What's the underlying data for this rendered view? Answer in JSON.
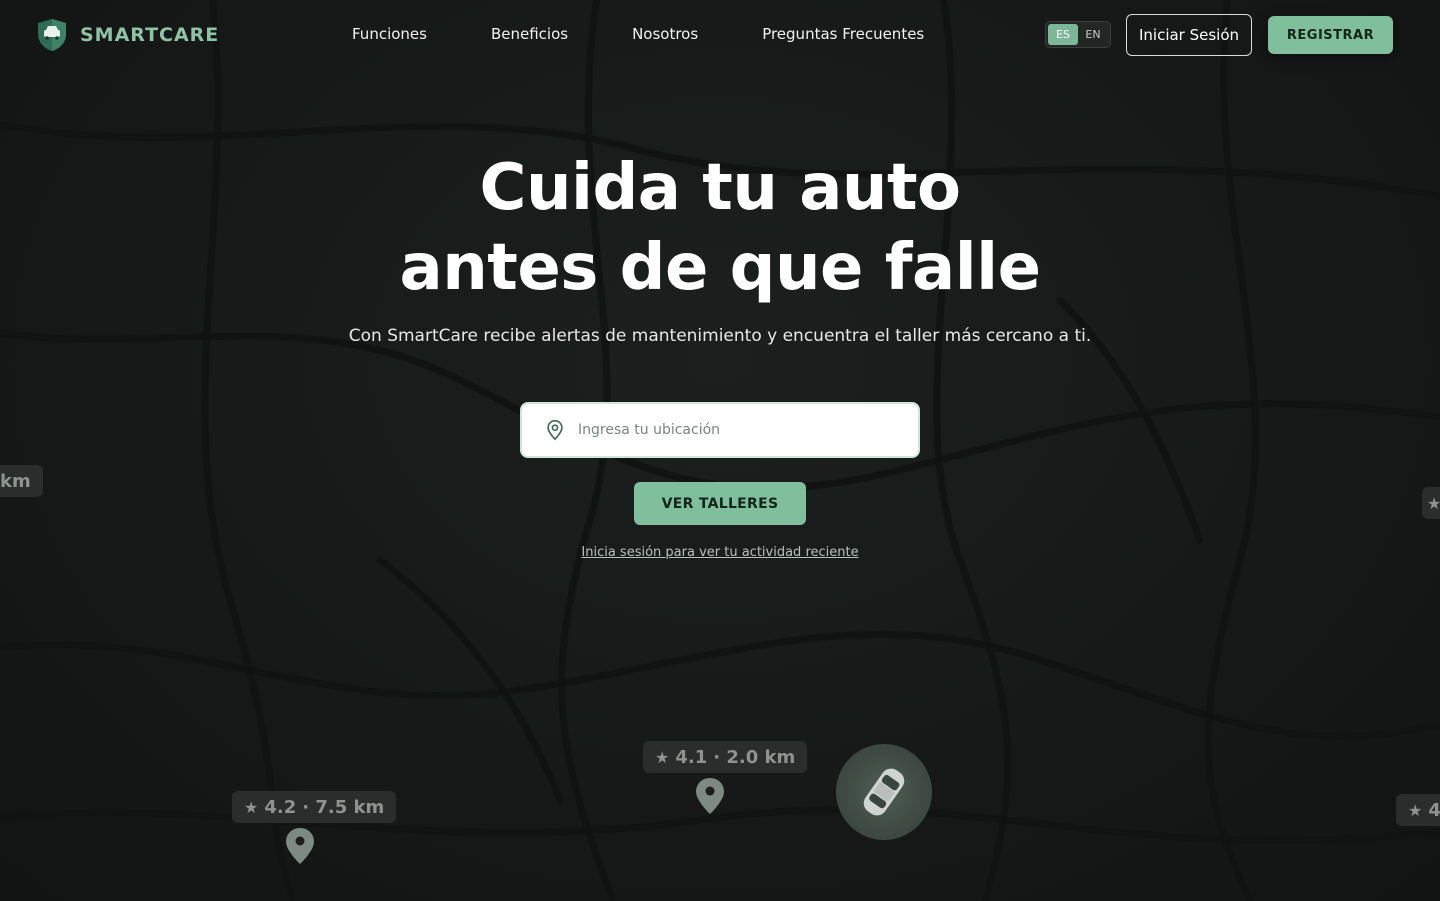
{
  "brand": {
    "name": "SMARTCARE"
  },
  "nav": {
    "items": [
      "Funciones",
      "Beneficios",
      "Nosotros",
      "Preguntas Frecuentes"
    ]
  },
  "language": {
    "options": [
      "ES",
      "EN"
    ],
    "selected": "ES"
  },
  "header_actions": {
    "login_label": "Iniciar Sesión",
    "register_label": "REGISTRAR"
  },
  "hero": {
    "title_line1": "Cuida tu auto",
    "title_line2": "antes de que falle",
    "subtitle": "Con SmartCare recibe alertas de mantenimiento y encuentra el taller más cercano a ti."
  },
  "search": {
    "placeholder": "Ingresa tu ubicación",
    "value": ""
  },
  "cta": {
    "label": "VER TALLERES"
  },
  "activity_link": {
    "label": "Inicia sesión para ver tu actividad reciente"
  },
  "map_markers": [
    {
      "rating": "",
      "distance": "km"
    },
    {
      "rating": "4.2",
      "distance": "· 7.5 km"
    },
    {
      "rating": "4.1",
      "distance": "· 2.0 km"
    },
    {
      "rating": "4",
      "distance": ""
    }
  ],
  "colors": {
    "accent": "#7fbf9b",
    "brand_text": "#8fc3a6",
    "background": "#151817"
  }
}
